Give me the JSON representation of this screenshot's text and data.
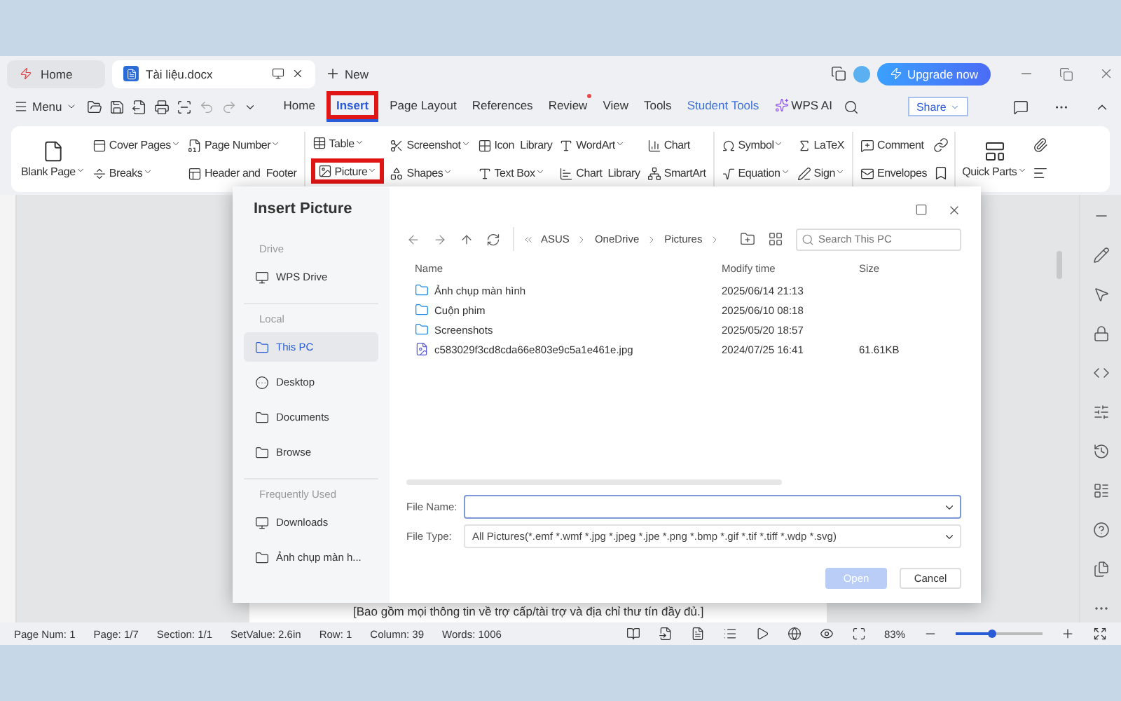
{
  "app_tabs": [
    {
      "label": "Home",
      "kind": "home",
      "selected": false
    },
    {
      "label": "Tài liệu.docx",
      "kind": "doc",
      "selected": true
    }
  ],
  "new_tab": "New",
  "upgrade": "Upgrade now",
  "menu": "Menu",
  "ribbon_tabs": [
    {
      "label": "Home",
      "kind": "tab",
      "selected": false,
      "highlighted": false,
      "dot": false
    },
    {
      "label": "Insert",
      "kind": "tab",
      "selected": true,
      "highlighted": true,
      "dot": false
    },
    {
      "label": "Page Layout",
      "kind": "tab",
      "selected": false,
      "highlighted": false,
      "dot": false
    },
    {
      "label": "References",
      "kind": "tab",
      "selected": false,
      "highlighted": false,
      "dot": false
    },
    {
      "label": "Review",
      "kind": "tab",
      "selected": false,
      "highlighted": false,
      "dot": true
    },
    {
      "label": "View",
      "kind": "tab",
      "selected": false,
      "highlighted": false,
      "dot": false
    },
    {
      "label": "Tools",
      "kind": "tab",
      "selected": false,
      "highlighted": false,
      "dot": false
    },
    {
      "label": "Student Tools",
      "kind": "accent",
      "selected": false,
      "highlighted": false,
      "dot": false
    },
    {
      "label": "WPS AI",
      "kind": "ai",
      "selected": false,
      "highlighted": false,
      "dot": false
    }
  ],
  "share": "Share",
  "ribbon": [
    {
      "columns": [
        [
          {
            "label": "Blank Page",
            "big": true,
            "dropdown": true,
            "highlighted": false
          }
        ],
        [
          {
            "label": "Cover Pages",
            "big": false,
            "dropdown": true,
            "highlighted": false
          },
          {
            "label": "Breaks",
            "big": false,
            "dropdown": true,
            "highlighted": false
          }
        ],
        [
          {
            "label": "Page Number",
            "big": false,
            "dropdown": true,
            "highlighted": false
          },
          {
            "label": "Header and  Footer",
            "big": false,
            "dropdown": false,
            "highlighted": false
          }
        ]
      ]
    },
    {
      "columns": [
        [
          {
            "label": "Table",
            "big": false,
            "dropdown": true,
            "highlighted": false
          },
          {
            "label": "Picture",
            "big": false,
            "dropdown": true,
            "highlighted": true
          }
        ],
        [
          {
            "label": "Screenshot",
            "big": false,
            "dropdown": true,
            "highlighted": false
          },
          {
            "label": "Shapes",
            "big": false,
            "dropdown": true,
            "highlighted": false
          }
        ],
        [
          {
            "label": "Icon  Library",
            "big": false,
            "dropdown": false,
            "highlighted": false
          },
          {
            "label": "Text Box",
            "big": false,
            "dropdown": true,
            "highlighted": false
          }
        ],
        [
          {
            "label": "WordArt",
            "big": false,
            "dropdown": true,
            "highlighted": false
          },
          {
            "label": "Chart  Library",
            "big": false,
            "dropdown": false,
            "highlighted": false
          }
        ],
        [
          {
            "label": "Chart",
            "big": false,
            "dropdown": false,
            "highlighted": false
          },
          {
            "label": "SmartArt",
            "big": false,
            "dropdown": false,
            "highlighted": false
          }
        ]
      ]
    },
    {
      "columns": [
        [
          {
            "label": "Symbol",
            "big": false,
            "dropdown": true,
            "highlighted": false
          },
          {
            "label": "Equation",
            "big": false,
            "dropdown": true,
            "highlighted": false
          }
        ],
        [
          {
            "label": "LaTeX",
            "big": false,
            "dropdown": false,
            "highlighted": false
          },
          {
            "label": "Sign",
            "big": false,
            "dropdown": true,
            "highlighted": false
          }
        ]
      ]
    },
    {
      "columns": [
        [
          {
            "label": "Comment",
            "big": false,
            "dropdown": false,
            "highlighted": false
          },
          {
            "label": "Envelopes",
            "big": false,
            "dropdown": false,
            "highlighted": false
          }
        ]
      ]
    },
    {
      "columns": [
        [
          {
            "label": "Quick Parts",
            "big": true,
            "dropdown": true,
            "highlighted": false
          }
        ]
      ]
    }
  ],
  "document": {
    "text": "[Bao gồm mọi thông tin về trợ cấp/tài trợ và địa chỉ thư tín đầy đủ.]"
  },
  "dialog": {
    "title": "Insert Picture",
    "sidebar": [
      {
        "kind": "header",
        "label": "Drive"
      },
      {
        "kind": "item",
        "label": "WPS Drive",
        "selected": false
      },
      {
        "kind": "header",
        "label": "Local"
      },
      {
        "kind": "item",
        "label": "This PC",
        "selected": true
      },
      {
        "kind": "item",
        "label": "Desktop",
        "selected": false
      },
      {
        "kind": "item",
        "label": "Documents",
        "selected": false
      },
      {
        "kind": "item",
        "label": "Browse",
        "selected": false
      },
      {
        "kind": "header",
        "label": "Frequently Used"
      },
      {
        "kind": "item",
        "label": "Downloads",
        "selected": false
      },
      {
        "kind": "item",
        "label": "Ảnh chụp màn h...",
        "selected": false
      }
    ],
    "breadcrumb": [
      "ASUS",
      "OneDrive",
      "Pictures"
    ],
    "search": {
      "placeholder": "Search This PC"
    },
    "columns": [
      "Name",
      "Modify time",
      "Size"
    ],
    "files": [
      {
        "kind": "folder",
        "name": "Ảnh chụp màn hình",
        "modified": "2025/06/14 21:13"
      },
      {
        "kind": "folder",
        "name": "Cuộn phim",
        "modified": "2025/06/10 08:18"
      },
      {
        "kind": "folder",
        "name": "Screenshots",
        "modified": "2025/05/20 18:57"
      },
      {
        "kind": "image",
        "name": "c583029f3cd8cda66e803e9c5a1e461e.jpg",
        "modified": "2024/07/25 16:41",
        "size": "61.61KB"
      }
    ],
    "file_name": {
      "label": "File Name:"
    },
    "file_type": {
      "label": "File Type:",
      "value": "All Pictures(*.emf *.wmf *.jpg *.jpeg *.jpe *.png *.bmp *.gif *.tif *.tiff *.wdp *.svg)"
    },
    "buttons": [
      {
        "label": "Open",
        "kind": "primary",
        "disabled": true
      },
      {
        "label": "Cancel",
        "kind": "secondary",
        "disabled": false
      }
    ]
  },
  "status": [
    "Page Num: 1",
    "Page: 1/7",
    "Section: 1/1",
    "SetValue: 2.6in",
    "Row: 1",
    "Column: 39",
    "Words: 1006"
  ],
  "zoom": {
    "reading": "83%",
    "level": 0.42
  }
}
